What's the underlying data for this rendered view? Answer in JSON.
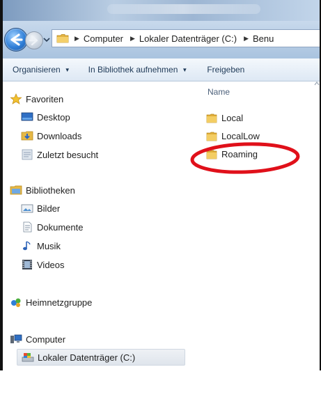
{
  "address_bar": {
    "crumbs": [
      "Computer",
      "Lokaler Datenträger (C:)",
      "Benu"
    ]
  },
  "toolbar": {
    "organize_label": "Organisieren",
    "library_label": "In Bibliothek aufnehmen",
    "share_label": "Freigeben"
  },
  "sidebar": {
    "favorites": {
      "label": "Favoriten",
      "items": [
        "Desktop",
        "Downloads",
        "Zuletzt besucht"
      ]
    },
    "libraries": {
      "label": "Bibliotheken",
      "items": [
        "Bilder",
        "Dokumente",
        "Musik",
        "Videos"
      ]
    },
    "homegroup": {
      "label": "Heimnetzgruppe"
    },
    "computer": {
      "label": "Computer",
      "items": [
        "Lokaler Datenträger (C:)"
      ]
    }
  },
  "content": {
    "column_header": "Name",
    "files": [
      "Local",
      "LocalLow",
      "Roaming"
    ]
  },
  "annotation": {
    "color": "#e0101a",
    "target": "Roaming"
  },
  "icons": {
    "back": "back-arrow-icon",
    "forward": "forward-arrow-icon",
    "folder": "folder-icon",
    "star": "star-icon"
  }
}
